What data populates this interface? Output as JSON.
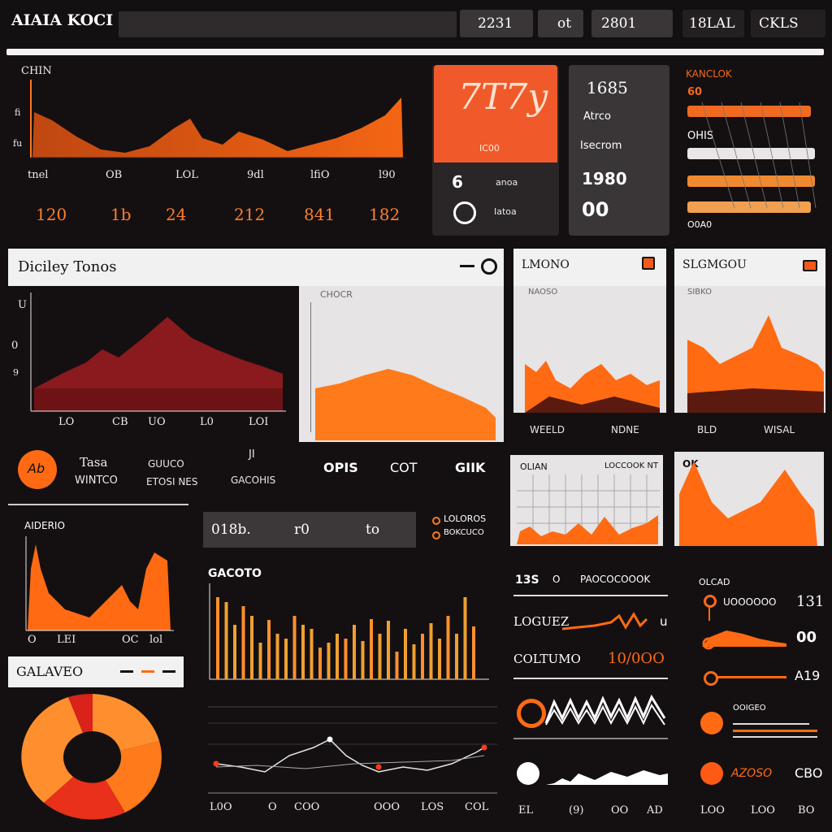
{
  "topbar": {
    "title": "AIAIA KOCI",
    "search": {
      "value": "",
      "placeholder": ""
    },
    "btn1": "2231",
    "btn2": "ot",
    "btn3": "2801",
    "btn4": "18LAL",
    "btn5": "CKLS"
  },
  "top_chart": {
    "title": "CHIN",
    "y_ticks": [
      "fi",
      "fu"
    ],
    "x_ticks": [
      "tnel",
      "OB",
      "LOL",
      "9dl",
      "lfiO",
      "l90"
    ],
    "values": [
      "120",
      "1b",
      "24",
      "212",
      "841",
      "182"
    ]
  },
  "kpi_orange": {
    "big": "7T7y",
    "sub": "IC00",
    "row1_num": "6",
    "row1_text": "anoa",
    "row2_text": "Iatoa"
  },
  "kpi_dark": {
    "title": "1685",
    "line1": "Atrco",
    "line2": "Isecrom",
    "line3": "1980",
    "line4": "00"
  },
  "hbar_panel": {
    "title": "KANCLOK",
    "labels": [
      "60",
      "OHIS",
      "O0A0"
    ],
    "bars": [
      0.95,
      0.98,
      0.98,
      0.95
    ],
    "colors": [
      "#f06a1f",
      "#e8e6e6",
      "#f08a30",
      "#f0a050"
    ]
  },
  "section_dialog": {
    "title": "Diciley Tonos",
    "y_ticks": [
      "U",
      "0",
      "9"
    ],
    "x_ticks": [
      "LO",
      "CB",
      "UO",
      "L0",
      "LOI"
    ]
  },
  "grey_chart": {
    "title": "CHOCR"
  },
  "small_chart1": {
    "title": "LMONO",
    "subtitle": "NAOSO",
    "x_ticks": [
      "WEELD",
      "NDNE"
    ]
  },
  "small_chart2": {
    "title": "SLGMGOU",
    "subtitle": "SIBKO",
    "x_ticks": [
      "BLD",
      "WISAL"
    ]
  },
  "stats_row": {
    "icon_label": "Ab",
    "a_line1": "Tasa",
    "a_line2": "WINTCO",
    "b_line1": "GUUCO",
    "b_line2": "ETOSI NES",
    "c_line1": "JI",
    "c_line2": "GACOHIS",
    "v1": "OPIS",
    "v2": "COT",
    "v3": "GIIK"
  },
  "small_chart3": {
    "title": "OLIAN",
    "right": "LOCCOOK NT"
  },
  "small_chart4": {
    "title": "OK"
  },
  "left_chart2": {
    "title": "AIDERIO",
    "x_ticks": [
      "O",
      "LEI",
      "OC",
      "lol"
    ]
  },
  "tabs": {
    "t1": "018b.",
    "t2": "r0",
    "t3": "to"
  },
  "legend_mid": {
    "l1": "LOLOROS",
    "l2": "BOKCUCO"
  },
  "bars_chart": {
    "title": "GACOTO"
  },
  "donut": {
    "title": "GALAVEO"
  },
  "line_chart": {
    "x_ticks": [
      "L0O",
      "O",
      "COO",
      "OOO",
      "LOS",
      "COL"
    ]
  },
  "list_panel": {
    "header_a": "13S",
    "header_b": "O",
    "header_c": "PAOCOCOOOK",
    "rows": [
      {
        "label": "LOGUEZ",
        "value": "u"
      },
      {
        "label": "COLTUMO",
        "value": "10/0OO"
      }
    ],
    "bottom_x": [
      "EL",
      "(9)",
      "OO",
      "AD"
    ]
  },
  "right_list": {
    "title": "OLCAD",
    "items": [
      {
        "label": "UOOOOOO",
        "value": "131"
      },
      {
        "label": "",
        "value": "00"
      },
      {
        "label": "",
        "value": "A19"
      },
      {
        "label": "OOIGEO",
        "value": ""
      },
      {
        "label": "AZOSO",
        "value": "CBO"
      }
    ],
    "x_ticks": [
      "LOO",
      "LOO",
      "BO"
    ]
  },
  "colors": {
    "accent": "#ff6a13",
    "accent2": "#ff8f2e",
    "dark_red": "#7e1518",
    "bg": "#141012"
  }
}
